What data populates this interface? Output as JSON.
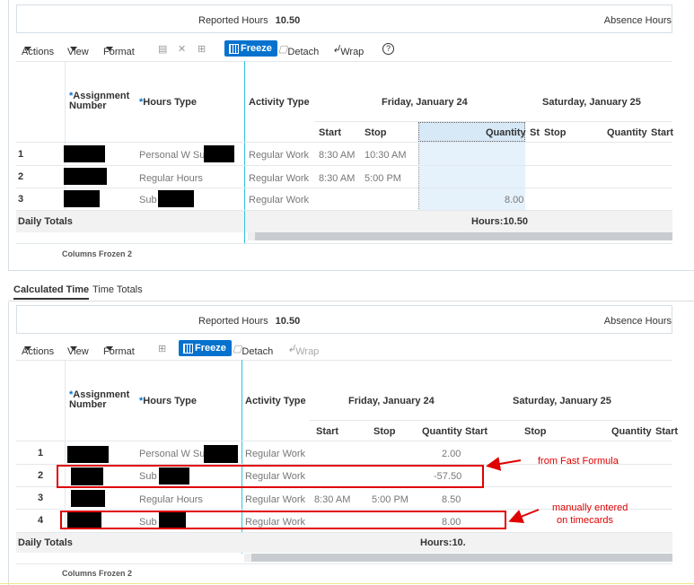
{
  "tabs": [
    {
      "label": "Calculated Time"
    },
    {
      "label": "Time Totals"
    }
  ],
  "toolbar": {
    "actions": "Actions",
    "view": "View",
    "format": "Format",
    "freeze": "Freeze",
    "detach": "Detach",
    "wrap": "Wrap"
  },
  "summary": {
    "reported_label": "Reported Hours",
    "reported_value": "10.50",
    "absence_label": "Absence Hours"
  },
  "columns": {
    "assignment": "Assignment Number",
    "hours_type": "Hours Type",
    "activity": "Activity Type",
    "day1": "Friday, January 24",
    "day2": "Saturday, January 25",
    "start": "Start",
    "stop": "Stop",
    "quantity": "Quantity",
    "start_trunc": "St",
    "start_trunc2": "Start",
    "start_trunc3": "Start"
  },
  "top_grid": {
    "rows": [
      {
        "num": "1",
        "hours_type": "Personal W Sub",
        "activity": "Regular Work",
        "start": "8:30 AM",
        "stop": "10:30 AM",
        "qty": ""
      },
      {
        "num": "2",
        "hours_type": "Regular Hours",
        "activity": "Regular Work",
        "start": "8:30 AM",
        "stop": "5:00 PM",
        "qty": ""
      },
      {
        "num": "3",
        "hours_type": "Sub",
        "activity": "Regular Work",
        "start": "",
        "stop": "",
        "qty": "8.00"
      }
    ],
    "daily_totals": "Daily Totals",
    "hours_total": "Hours:10.50",
    "frozen": "Columns Frozen",
    "frozen_count": "2"
  },
  "bottom_grid": {
    "rows": [
      {
        "num": "1",
        "hours_type": "Personal W Sub",
        "activity": "Regular Work",
        "start": "",
        "stop": "",
        "qty": "2.00"
      },
      {
        "num": "2",
        "hours_type": "Sub",
        "activity": "Regular Work",
        "start": "",
        "stop": "",
        "qty": "-57.50"
      },
      {
        "num": "3",
        "hours_type": "Regular Hours",
        "activity": "Regular Work",
        "start": "8:30 AM",
        "stop": "5:00 PM",
        "qty": "8.50"
      },
      {
        "num": "4",
        "hours_type": "Sub",
        "activity": "Regular Work",
        "start": "",
        "stop": "",
        "qty": "8.00"
      }
    ],
    "daily_totals": "Daily Totals",
    "hours_total": "Hours:10.",
    "frozen": "Columns Frozen",
    "frozen_count": "2"
  },
  "annotations": {
    "fast_formula": "from Fast Formula",
    "manual_line1": "manually entered",
    "manual_line2": "on timecards"
  },
  "colors": {
    "accent": "#0572ce",
    "annotation": "#e00000",
    "frozen_line": "#31c1dc",
    "selected_cell": "#e5f1fb"
  }
}
